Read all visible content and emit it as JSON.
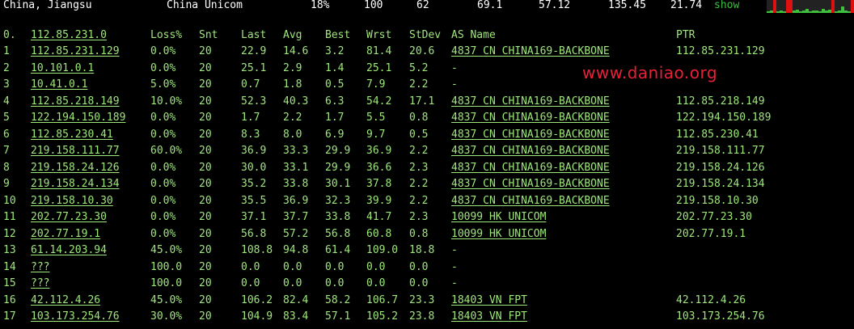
{
  "header": {
    "location": "China, Jiangsu",
    "isp": "China Unicom",
    "loss": "18%",
    "sent": "100",
    "last": "62",
    "avg": "69.1",
    "best": "57.12",
    "worst": "135.45",
    "stdev": "21.74",
    "show_label": "show"
  },
  "columns": {
    "idx": "0.",
    "host": "112.85.231.0",
    "loss": "Loss%",
    "snt": "Snt",
    "last": "Last",
    "avg": "Avg",
    "best": "Best",
    "wrst": "Wrst",
    "stdev": "StDev",
    "as": "AS Name",
    "ptr": "PTR"
  },
  "rows": [
    {
      "idx": "1",
      "host": "112.85.231.129",
      "loss": "0.0%",
      "snt": "20",
      "last": "22.9",
      "avg": "14.6",
      "best": "3.2",
      "wrst": "81.4",
      "stdev": "20.6",
      "as": "4837  CN CHINA169-BACKBONE",
      "ptr": "112.85.231.129"
    },
    {
      "idx": "2",
      "host": "10.101.0.1",
      "loss": "0.0%",
      "snt": "20",
      "last": "25.1",
      "avg": "2.9",
      "best": "1.4",
      "wrst": "25.1",
      "stdev": "5.2",
      "as": "-",
      "ptr": ""
    },
    {
      "idx": "3",
      "host": "10.41.0.1",
      "loss": "5.0%",
      "snt": "20",
      "last": "0.7",
      "avg": "1.8",
      "best": "0.5",
      "wrst": "7.9",
      "stdev": "2.2",
      "as": "-",
      "ptr": ""
    },
    {
      "idx": "4",
      "host": "112.85.218.149",
      "loss": "10.0%",
      "snt": "20",
      "last": "52.3",
      "avg": "40.3",
      "best": "6.3",
      "wrst": "54.2",
      "stdev": "17.1",
      "as": "4837  CN CHINA169-BACKBONE",
      "ptr": "112.85.218.149"
    },
    {
      "idx": "5",
      "host": "122.194.150.189",
      "loss": "0.0%",
      "snt": "20",
      "last": "1.7",
      "avg": "2.2",
      "best": "1.7",
      "wrst": "5.5",
      "stdev": "0.8",
      "as": "4837  CN CHINA169-BACKBONE",
      "ptr": "122.194.150.189"
    },
    {
      "idx": "6",
      "host": "112.85.230.41",
      "loss": "0.0%",
      "snt": "20",
      "last": "8.3",
      "avg": "8.0",
      "best": "6.9",
      "wrst": "9.7",
      "stdev": "0.5",
      "as": "4837  CN CHINA169-BACKBONE",
      "ptr": "112.85.230.41"
    },
    {
      "idx": "7",
      "host": "219.158.111.77",
      "loss": "60.0%",
      "snt": "20",
      "last": "36.9",
      "avg": "33.3",
      "best": "29.9",
      "wrst": "36.9",
      "stdev": "2.2",
      "as": "4837  CN CHINA169-BACKBONE",
      "ptr": "219.158.111.77"
    },
    {
      "idx": "8",
      "host": "219.158.24.126",
      "loss": "0.0%",
      "snt": "20",
      "last": "30.0",
      "avg": "33.1",
      "best": "29.9",
      "wrst": "36.6",
      "stdev": "2.3",
      "as": "4837  CN CHINA169-BACKBONE",
      "ptr": "219.158.24.126"
    },
    {
      "idx": "9",
      "host": "219.158.24.134",
      "loss": "0.0%",
      "snt": "20",
      "last": "35.2",
      "avg": "33.8",
      "best": "30.1",
      "wrst": "37.8",
      "stdev": "2.2",
      "as": "4837  CN CHINA169-BACKBONE",
      "ptr": "219.158.24.134"
    },
    {
      "idx": "10",
      "host": "219.158.10.30",
      "loss": "0.0%",
      "snt": "20",
      "last": "35.5",
      "avg": "36.9",
      "best": "32.3",
      "wrst": "39.9",
      "stdev": "2.2",
      "as": "4837  CN CHINA169-BACKBONE",
      "ptr": "219.158.10.30"
    },
    {
      "idx": "11",
      "host": "202.77.23.30",
      "loss": "0.0%",
      "snt": "20",
      "last": "37.1",
      "avg": "37.7",
      "best": "33.8",
      "wrst": "41.7",
      "stdev": "2.3",
      "as": "10099 HK UNICOM",
      "ptr": "202.77.23.30"
    },
    {
      "idx": "12",
      "host": "202.77.19.1",
      "loss": "0.0%",
      "snt": "20",
      "last": "56.8",
      "avg": "57.2",
      "best": "56.8",
      "wrst": "60.8",
      "stdev": "0.8",
      "as": "10099 HK UNICOM",
      "ptr": "202.77.19.1"
    },
    {
      "idx": "13",
      "host": "61.14.203.94",
      "loss": "45.0%",
      "snt": "20",
      "last": "108.8",
      "avg": "94.8",
      "best": "61.4",
      "wrst": "109.0",
      "stdev": "18.8",
      "as": "-",
      "ptr": ""
    },
    {
      "idx": "14",
      "host": "???",
      "loss": "100.0",
      "snt": "20",
      "last": "0.0",
      "avg": "0.0",
      "best": "0.0",
      "wrst": "0.0",
      "stdev": "0.0",
      "as": "-",
      "ptr": ""
    },
    {
      "idx": "15",
      "host": "???",
      "loss": "100.0",
      "snt": "20",
      "last": "0.0",
      "avg": "0.0",
      "best": "0.0",
      "wrst": "0.0",
      "stdev": "0.0",
      "as": "-",
      "ptr": ""
    },
    {
      "idx": "16",
      "host": "42.112.4.26",
      "loss": "45.0%",
      "snt": "20",
      "last": "106.2",
      "avg": "82.4",
      "best": "58.2",
      "wrst": "106.7",
      "stdev": "23.3",
      "as": "18403 VN FPT",
      "ptr": "42.112.4.26"
    },
    {
      "idx": "17",
      "host": "103.173.254.76",
      "loss": "30.0%",
      "snt": "20",
      "last": "104.9",
      "avg": "83.4",
      "best": "57.1",
      "wrst": "105.2",
      "stdev": "23.8",
      "as": "18403 VN FPT",
      "ptr": "103.173.254.76"
    }
  ],
  "watermark": "www.daniao.org",
  "colors": {
    "text": "#9ee87a",
    "background": "#000000",
    "watermark": "#e8203a",
    "spark_ok": "#3fbf3f",
    "spark_loss": "#e01010"
  },
  "sparkline": [
    {
      "level": 0.15,
      "loss": false
    },
    {
      "level": 0.2,
      "loss": false
    },
    {
      "level": 1.0,
      "loss": true
    },
    {
      "level": 0.15,
      "loss": false
    },
    {
      "level": 0.2,
      "loss": false
    },
    {
      "level": 0.15,
      "loss": false
    },
    {
      "level": 1.0,
      "loss": true
    },
    {
      "level": 1.0,
      "loss": true
    },
    {
      "level": 0.2,
      "loss": false
    },
    {
      "level": 0.25,
      "loss": false
    },
    {
      "level": 0.15,
      "loss": false
    },
    {
      "level": 0.2,
      "loss": false
    },
    {
      "level": 0.3,
      "loss": false
    },
    {
      "level": 0.15,
      "loss": false
    },
    {
      "level": 0.2,
      "loss": false
    },
    {
      "level": 0.2,
      "loss": false
    },
    {
      "level": 0.15,
      "loss": false
    },
    {
      "level": 0.3,
      "loss": false
    },
    {
      "level": 0.2,
      "loss": false
    },
    {
      "level": 0.25,
      "loss": false
    },
    {
      "level": 1.0,
      "loss": true
    },
    {
      "level": 0.15,
      "loss": false
    },
    {
      "level": 0.2,
      "loss": false
    },
    {
      "level": 0.5,
      "loss": false
    },
    {
      "level": 0.2,
      "loss": false
    },
    {
      "level": 0.15,
      "loss": false
    },
    {
      "level": 1.0,
      "loss": true
    }
  ]
}
